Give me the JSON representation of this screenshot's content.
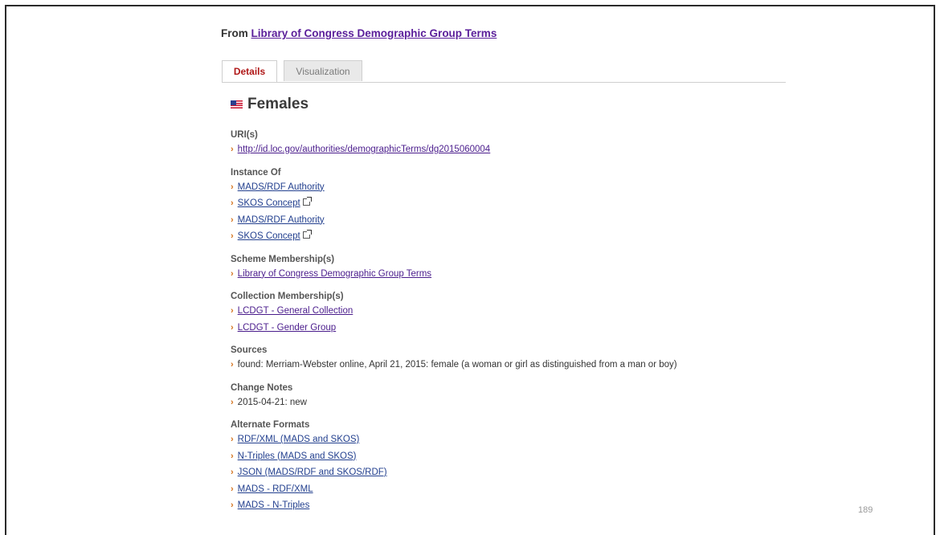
{
  "from": {
    "prefix": "From ",
    "link": "Library of Congress Demographic Group Terms"
  },
  "tabs": {
    "details": "Details",
    "visualization": "Visualization"
  },
  "title": "Females",
  "sections": {
    "uri": {
      "label": "URI(s)",
      "items": [
        "http://id.loc.gov/authorities/demographicTerms/dg2015060004"
      ]
    },
    "instance": {
      "label": "Instance Of",
      "items": [
        "MADS/RDF Authority",
        "SKOS Concept",
        "MADS/RDF Authority",
        "SKOS Concept"
      ]
    },
    "scheme": {
      "label": "Scheme Membership(s)",
      "items": [
        "Library of Congress Demographic Group Terms"
      ]
    },
    "collection": {
      "label": "Collection Membership(s)",
      "items": [
        "LCDGT - General Collection",
        "LCDGT - Gender Group"
      ]
    },
    "sources": {
      "label": "Sources",
      "items": [
        "found: Merriam-Webster online, April 21, 2015: female (a woman or girl as distinguished from a man or boy)"
      ]
    },
    "notes": {
      "label": "Change Notes",
      "items": [
        "2015-04-21: new"
      ]
    },
    "formats": {
      "label": "Alternate Formats",
      "items": [
        "RDF/XML (MADS and SKOS)",
        "N-Triples (MADS and SKOS)",
        "JSON (MADS/RDF and SKOS/RDF)",
        "MADS - RDF/XML",
        "MADS - N-Triples"
      ]
    }
  },
  "page_number": "189"
}
